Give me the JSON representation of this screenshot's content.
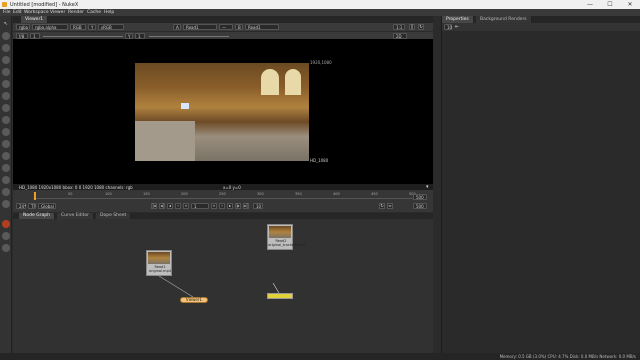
{
  "window": {
    "title": "Untitled [modified] - NukeX",
    "min": "—",
    "max": "☐",
    "close": "✕"
  },
  "menu": [
    "File",
    "Edit",
    "Workspace",
    "Viewer",
    "Render",
    "Cache",
    "Help"
  ],
  "viewer_tab": "Viewer1",
  "viewer_controls": {
    "channels": "rgba",
    "layer": "rgba.alpha",
    "colorspace_a": "RGB",
    "gamma_label": "Y",
    "colorspace_b": "sRGB",
    "input_a": "A",
    "input_a_node": "Read1",
    "input_b": "B",
    "input_b_node": "Read1",
    "zoom": "1:1",
    "view_mode": "2D",
    "frame_num": "f/8",
    "exposure": "1",
    "y_val": "Y",
    "y_num": "1"
  },
  "viewer": {
    "format_top": "1920,1080",
    "format_bottom": "HD_1080",
    "info_left": "HD_1080 1920x1080  bbox: 0 0 1920 1080 channels: rgb",
    "info_right": "x=0 y=0"
  },
  "timeline": {
    "fps_label": "24*",
    "tf_label": "TF",
    "global_label": "Global",
    "ticks": [
      "1",
      "50",
      "100",
      "150",
      "200",
      "250",
      "300",
      "350",
      "400",
      "450",
      "500"
    ],
    "end_top": "500",
    "end_bottom": "500",
    "current_frame": "1",
    "step": "10"
  },
  "panel_tabs": [
    "Node Graph",
    "Curve Editor",
    "Dope Sheet"
  ],
  "nodes": {
    "read1": {
      "name": "Read1",
      "file": "original.mp4"
    },
    "read2": {
      "name": "Read2",
      "file": "original_tracked.mp4"
    },
    "viewer1": {
      "name": "Viewer1"
    }
  },
  "properties": {
    "tabs": [
      "Properties",
      "Background Renders"
    ],
    "count": "10"
  },
  "status": "Memory: 0.5 GB (3.0%)  CPU: 4.7%  Disk: 0.0 MB/s  Network: 0.0 MB/s"
}
